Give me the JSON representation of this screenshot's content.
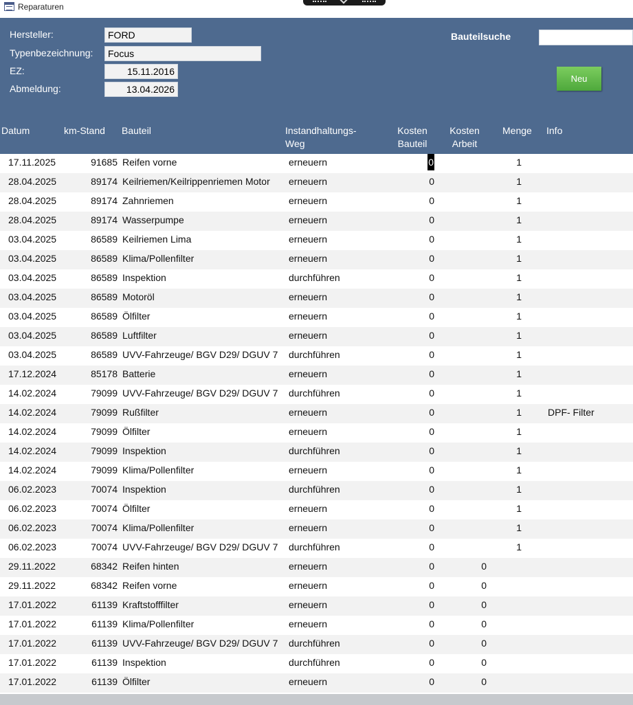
{
  "window": {
    "title": "Reparaturen"
  },
  "vehicle": {
    "hersteller_label": "Hersteller:",
    "hersteller": "FORD",
    "typ_label": "Typenbezeichnung:",
    "typ": "Focus",
    "ez_label": "EZ:",
    "ez": "15.11.2016",
    "abmeldung_label": "Abmeldung:",
    "abmeldung": "13.04.2026"
  },
  "search": {
    "label": "Bauteilsuche",
    "value": ""
  },
  "buttons": {
    "neu": "Neu"
  },
  "columns": {
    "datum": "Datum",
    "km": "km-Stand",
    "bauteil": "Bauteil",
    "weg_1": "Instandhaltungs-",
    "weg_2": "Weg",
    "kb_1": "Kosten",
    "kb_2": "Bauteil",
    "ka_1": "Kosten",
    "ka_2": "Arbeit",
    "menge": "Menge",
    "info": "Info"
  },
  "colors": {
    "header": "#4e6a8f",
    "button": "#5cb848",
    "row_alt": "#f2f2f2"
  },
  "rows": [
    {
      "datum": "17.11.2025",
      "km": "91685",
      "bauteil": "Reifen vorne",
      "weg": "erneuern",
      "kosten_bauteil": "0",
      "kosten_arbeit": "",
      "menge": "1",
      "info": ""
    },
    {
      "datum": "28.04.2025",
      "km": "89174",
      "bauteil": "Keilriemen/Keilrippenriemen Motor",
      "weg": "erneuern",
      "kosten_bauteil": "0",
      "kosten_arbeit": "",
      "menge": "1",
      "info": ""
    },
    {
      "datum": "28.04.2025",
      "km": "89174",
      "bauteil": "Zahnriemen",
      "weg": "erneuern",
      "kosten_bauteil": "0",
      "kosten_arbeit": "",
      "menge": "1",
      "info": ""
    },
    {
      "datum": "28.04.2025",
      "km": "89174",
      "bauteil": "Wasserpumpe",
      "weg": "erneuern",
      "kosten_bauteil": "0",
      "kosten_arbeit": "",
      "menge": "1",
      "info": ""
    },
    {
      "datum": "03.04.2025",
      "km": "86589",
      "bauteil": "Keilriemen Lima",
      "weg": "erneuern",
      "kosten_bauteil": "0",
      "kosten_arbeit": "",
      "menge": "1",
      "info": ""
    },
    {
      "datum": "03.04.2025",
      "km": "86589",
      "bauteil": "Klima/Pollenfilter",
      "weg": "erneuern",
      "kosten_bauteil": "0",
      "kosten_arbeit": "",
      "menge": "1",
      "info": ""
    },
    {
      "datum": "03.04.2025",
      "km": "86589",
      "bauteil": "Inspektion",
      "weg": "durchführen",
      "kosten_bauteil": "0",
      "kosten_arbeit": "",
      "menge": "1",
      "info": ""
    },
    {
      "datum": "03.04.2025",
      "km": "86589",
      "bauteil": "Motoröl",
      "weg": "erneuern",
      "kosten_bauteil": "0",
      "kosten_arbeit": "",
      "menge": "1",
      "info": ""
    },
    {
      "datum": "03.04.2025",
      "km": "86589",
      "bauteil": "Ölfilter",
      "weg": "erneuern",
      "kosten_bauteil": "0",
      "kosten_arbeit": "",
      "menge": "1",
      "info": ""
    },
    {
      "datum": "03.04.2025",
      "km": "86589",
      "bauteil": "Luftfilter",
      "weg": "erneuern",
      "kosten_bauteil": "0",
      "kosten_arbeit": "",
      "menge": "1",
      "info": ""
    },
    {
      "datum": "03.04.2025",
      "km": "86589",
      "bauteil": "UVV-Fahrzeuge/ BGV D29/ DGUV 7",
      "weg": "durchführen",
      "kosten_bauteil": "0",
      "kosten_arbeit": "",
      "menge": "1",
      "info": ""
    },
    {
      "datum": "17.12.2024",
      "km": "85178",
      "bauteil": "Batterie",
      "weg": "erneuern",
      "kosten_bauteil": "0",
      "kosten_arbeit": "",
      "menge": "1",
      "info": ""
    },
    {
      "datum": "14.02.2024",
      "km": "79099",
      "bauteil": "UVV-Fahrzeuge/ BGV D29/ DGUV 7",
      "weg": "durchführen",
      "kosten_bauteil": "0",
      "kosten_arbeit": "",
      "menge": "1",
      "info": ""
    },
    {
      "datum": "14.02.2024",
      "km": "79099",
      "bauteil": "Rußfilter",
      "weg": "erneuern",
      "kosten_bauteil": "0",
      "kosten_arbeit": "",
      "menge": "1",
      "info": "DPF- Filter"
    },
    {
      "datum": "14.02.2024",
      "km": "79099",
      "bauteil": "Ölfilter",
      "weg": "erneuern",
      "kosten_bauteil": "0",
      "kosten_arbeit": "",
      "menge": "1",
      "info": ""
    },
    {
      "datum": "14.02.2024",
      "km": "79099",
      "bauteil": "Inspektion",
      "weg": "durchführen",
      "kosten_bauteil": "0",
      "kosten_arbeit": "",
      "menge": "1",
      "info": ""
    },
    {
      "datum": "14.02.2024",
      "km": "79099",
      "bauteil": "Klima/Pollenfilter",
      "weg": "erneuern",
      "kosten_bauteil": "0",
      "kosten_arbeit": "",
      "menge": "1",
      "info": ""
    },
    {
      "datum": "06.02.2023",
      "km": "70074",
      "bauteil": "Inspektion",
      "weg": "durchführen",
      "kosten_bauteil": "0",
      "kosten_arbeit": "",
      "menge": "1",
      "info": ""
    },
    {
      "datum": "06.02.2023",
      "km": "70074",
      "bauteil": "Ölfilter",
      "weg": "erneuern",
      "kosten_bauteil": "0",
      "kosten_arbeit": "",
      "menge": "1",
      "info": ""
    },
    {
      "datum": "06.02.2023",
      "km": "70074",
      "bauteil": "Klima/Pollenfilter",
      "weg": "erneuern",
      "kosten_bauteil": "0",
      "kosten_arbeit": "",
      "menge": "1",
      "info": ""
    },
    {
      "datum": "06.02.2023",
      "km": "70074",
      "bauteil": "UVV-Fahrzeuge/ BGV D29/ DGUV 7",
      "weg": "durchführen",
      "kosten_bauteil": "0",
      "kosten_arbeit": "",
      "menge": "1",
      "info": ""
    },
    {
      "datum": "29.11.2022",
      "km": "68342",
      "bauteil": "Reifen hinten",
      "weg": "erneuern",
      "kosten_bauteil": "0",
      "kosten_arbeit": "0",
      "menge": "",
      "info": ""
    },
    {
      "datum": "29.11.2022",
      "km": "68342",
      "bauteil": "Reifen vorne",
      "weg": "erneuern",
      "kosten_bauteil": "0",
      "kosten_arbeit": "0",
      "menge": "",
      "info": ""
    },
    {
      "datum": "17.01.2022",
      "km": "61139",
      "bauteil": "Kraftstofffilter",
      "weg": "erneuern",
      "kosten_bauteil": "0",
      "kosten_arbeit": "0",
      "menge": "",
      "info": ""
    },
    {
      "datum": "17.01.2022",
      "km": "61139",
      "bauteil": "Klima/Pollenfilter",
      "weg": "erneuern",
      "kosten_bauteil": "0",
      "kosten_arbeit": "0",
      "menge": "",
      "info": ""
    },
    {
      "datum": "17.01.2022",
      "km": "61139",
      "bauteil": "UVV-Fahrzeuge/ BGV D29/ DGUV 7",
      "weg": "durchführen",
      "kosten_bauteil": "0",
      "kosten_arbeit": "0",
      "menge": "",
      "info": ""
    },
    {
      "datum": "17.01.2022",
      "km": "61139",
      "bauteil": "Inspektion",
      "weg": "durchführen",
      "kosten_bauteil": "0",
      "kosten_arbeit": "0",
      "menge": "",
      "info": ""
    },
    {
      "datum": "17.01.2022",
      "km": "61139",
      "bauteil": "Ölfilter",
      "weg": "erneuern",
      "kosten_bauteil": "0",
      "kosten_arbeit": "0",
      "menge": "",
      "info": ""
    }
  ]
}
